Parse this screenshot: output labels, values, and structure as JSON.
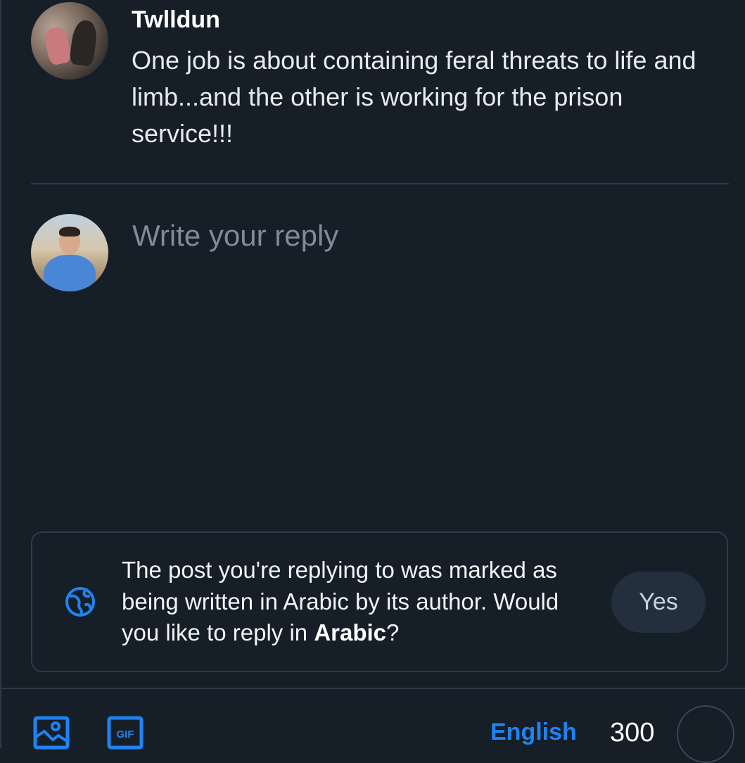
{
  "post": {
    "author": "Twlldun",
    "text": "One job is about containing feral threats to life and limb...and the other is working for the prison service!!!"
  },
  "composer": {
    "placeholder": "Write your reply",
    "value": ""
  },
  "language_notice": {
    "text_before": "The post you're replying to was marked as being written in Arabic by its author. Would you like to reply in ",
    "language": "Arabic",
    "text_after": "?",
    "confirm_label": "Yes",
    "icon": "globe-icon"
  },
  "toolbar": {
    "image_icon": "image-icon",
    "gif_icon": "gif-icon",
    "language": "English",
    "char_remaining": "300",
    "progress": 0
  },
  "colors": {
    "background": "#161e27",
    "accent": "#1f84f2",
    "border": "#2e3a47",
    "button_bg": "#232f3c"
  }
}
